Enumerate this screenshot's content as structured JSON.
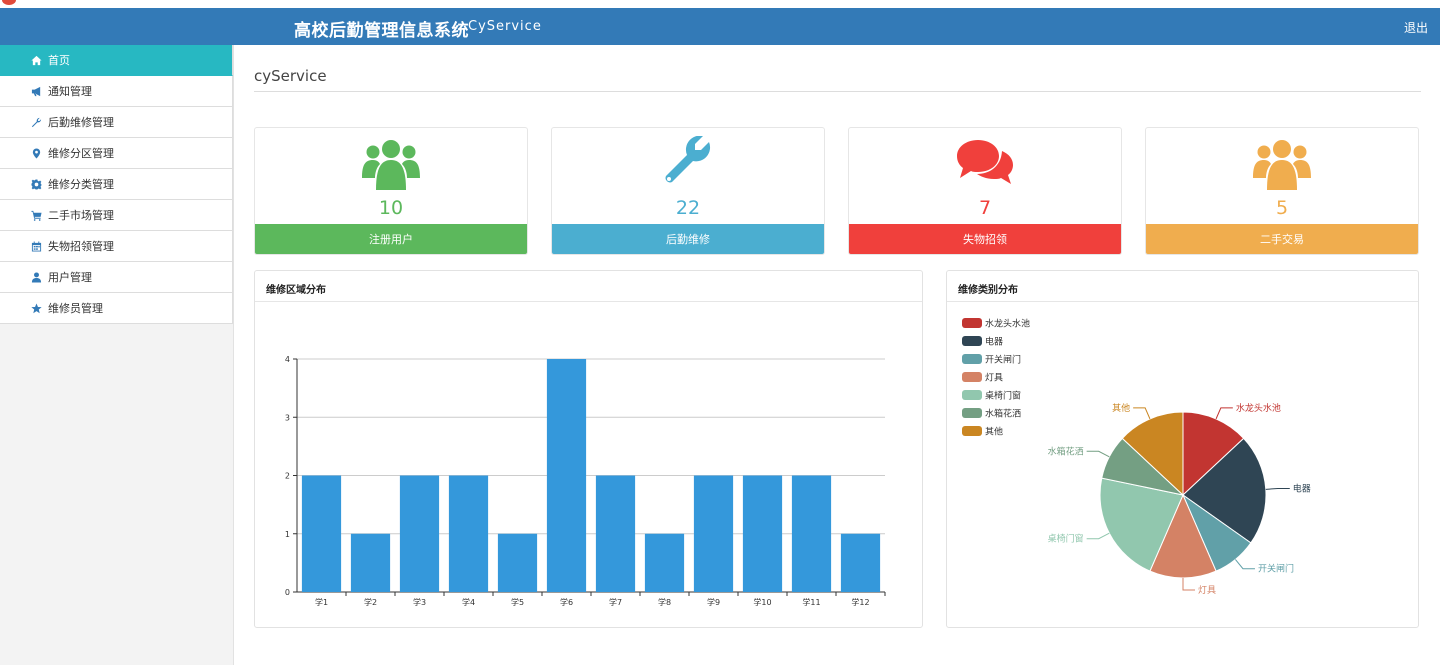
{
  "header": {
    "title": "高校后勤管理信息系统",
    "subtitle": "CyService",
    "logout_label": "退出"
  },
  "sidebar": {
    "items": [
      {
        "label": "首页",
        "icon": "home-icon",
        "active": true
      },
      {
        "label": "通知管理",
        "icon": "bullhorn-icon",
        "active": false
      },
      {
        "label": "后勤维修管理",
        "icon": "wrench-icon",
        "active": false
      },
      {
        "label": "维修分区管理",
        "icon": "map-marker-icon",
        "active": false
      },
      {
        "label": "维修分类管理",
        "icon": "gear-icon",
        "active": false
      },
      {
        "label": "二手市场管理",
        "icon": "cart-icon",
        "active": false
      },
      {
        "label": "失物招领管理",
        "icon": "calendar-icon",
        "active": false
      },
      {
        "label": "用户管理",
        "icon": "user-icon",
        "active": false
      },
      {
        "label": "维修员管理",
        "icon": "star-icon",
        "active": false
      }
    ]
  },
  "main": {
    "page_title": "cyService"
  },
  "stats": [
    {
      "value": "10",
      "label": "注册用户",
      "color": "#5cb85c",
      "icon": "users-icon"
    },
    {
      "value": "22",
      "label": "后勤维修",
      "color": "#4baed0",
      "icon": "wrench-icon"
    },
    {
      "value": "7",
      "label": "失物招领",
      "color": "#f0403c",
      "icon": "comments-icon"
    },
    {
      "value": "5",
      "label": "二手交易",
      "color": "#f0ad4e",
      "icon": "users-icon"
    }
  ],
  "panels": {
    "bar_title": "维修区域分布",
    "pie_title": "维修类别分布"
  },
  "chart_data": [
    {
      "type": "bar",
      "categories": [
        "学1",
        "学2",
        "学3",
        "学4",
        "学5",
        "学6",
        "学7",
        "学8",
        "学9",
        "学10",
        "学11",
        "学12"
      ],
      "values": [
        2,
        1,
        2,
        2,
        1,
        4,
        2,
        1,
        2,
        2,
        2,
        1
      ],
      "ylim": [
        0,
        4
      ],
      "yticks": [
        0,
        1,
        2,
        3,
        4
      ],
      "grid": true,
      "color": "#3498db"
    },
    {
      "type": "pie",
      "legend_position": "top-left",
      "slices": [
        {
          "label": "水龙头水池",
          "value": 3,
          "color": "#c23531"
        },
        {
          "label": "电器",
          "value": 5,
          "color": "#2f4554"
        },
        {
          "label": "开关闸门",
          "value": 2,
          "color": "#61a0a8"
        },
        {
          "label": "灯具",
          "value": 3,
          "color": "#d48265"
        },
        {
          "label": "桌椅门窗",
          "value": 5,
          "color": "#91c7ae"
        },
        {
          "label": "水箱花洒",
          "value": 2,
          "color": "#749f83"
        },
        {
          "label": "其他",
          "value": 3,
          "color": "#ca8622"
        }
      ]
    }
  ]
}
